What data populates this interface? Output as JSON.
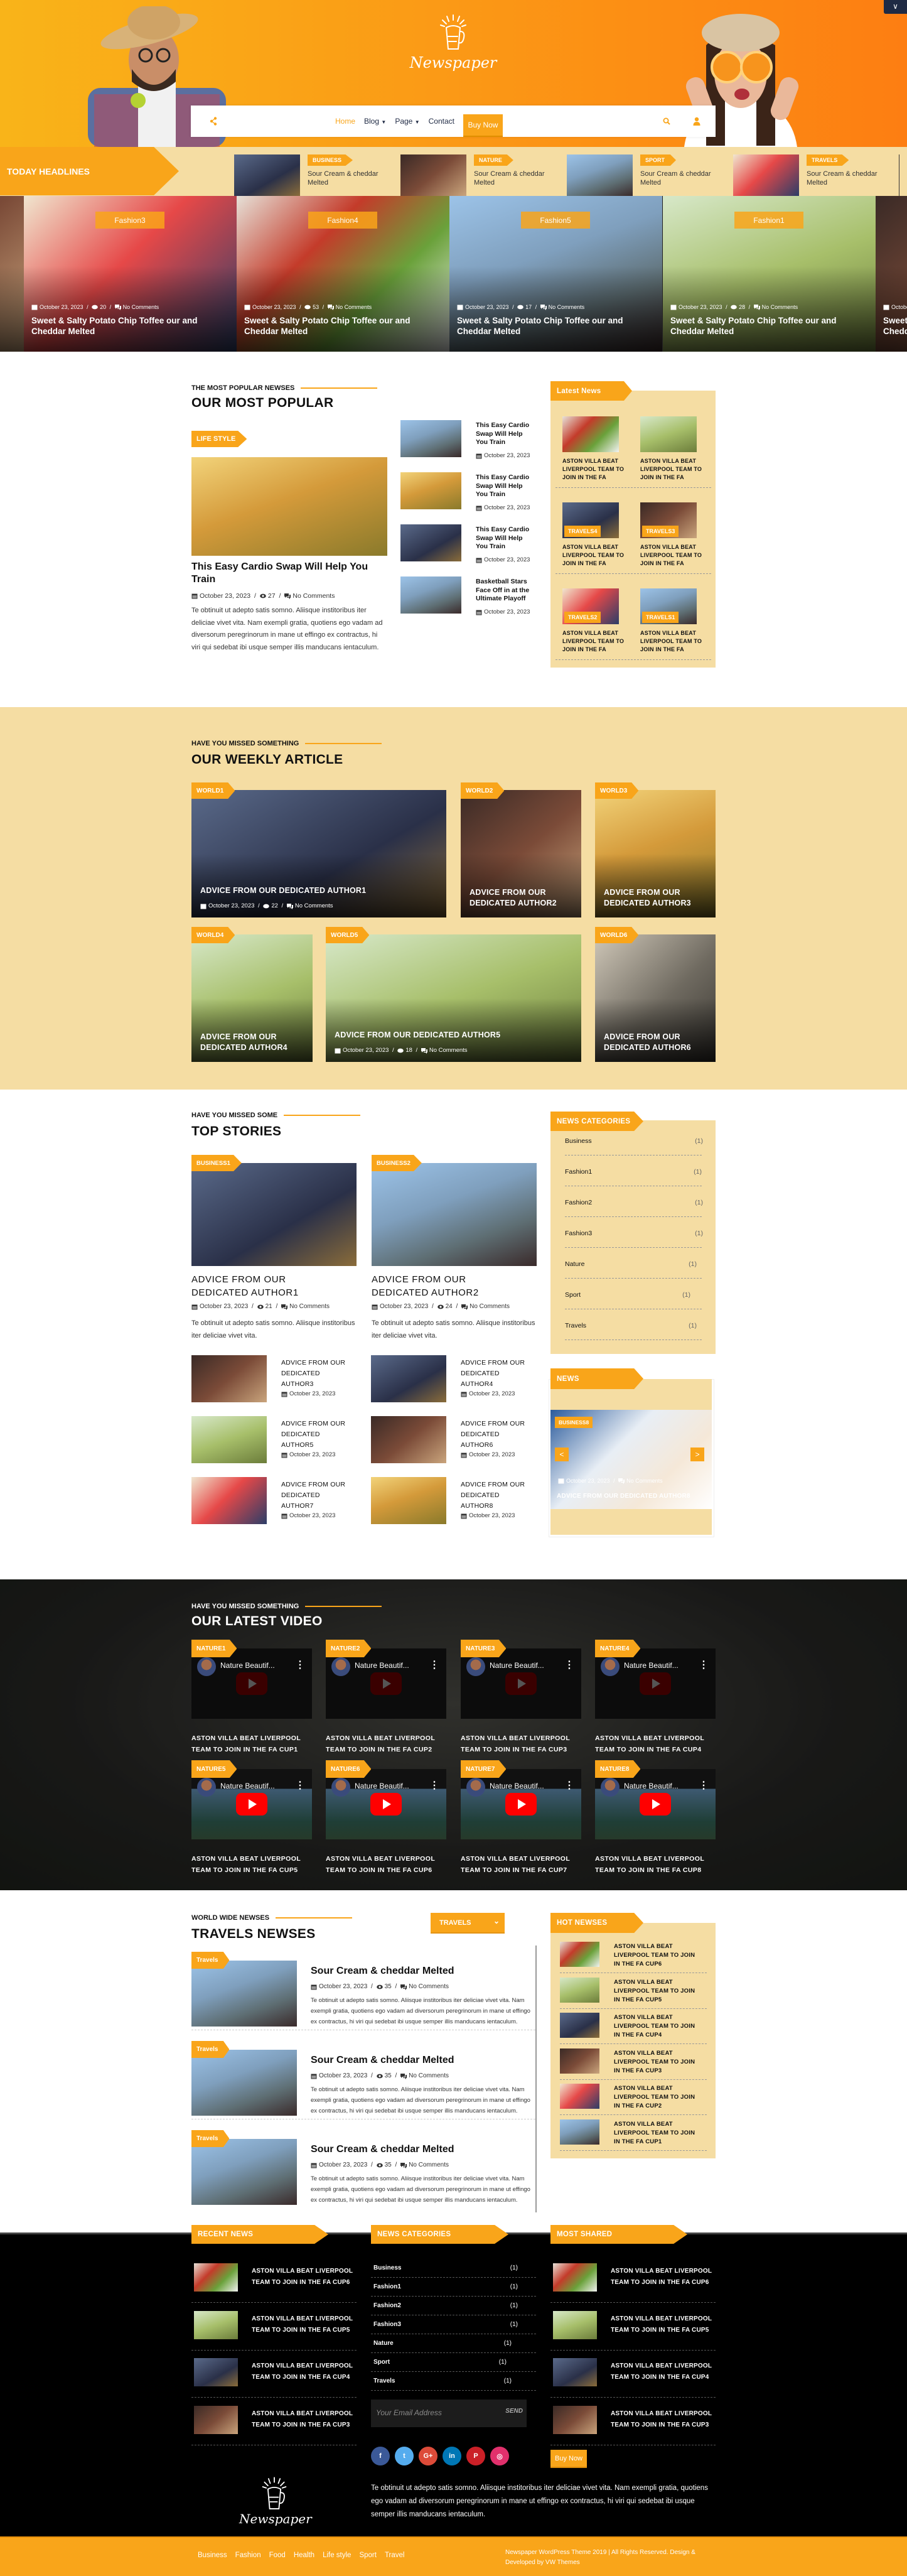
{
  "colors": {
    "accent": "#f9a51a",
    "beige": "#f5dda3",
    "footer_bg": "#000000",
    "header_gradient": [
      "#f9b419",
      "#fd7e12"
    ]
  },
  "header": {
    "logo_text": "Newspaper",
    "nav": {
      "items": [
        {
          "label": "Home",
          "active": true
        },
        {
          "label": "Blog",
          "dropdown": true
        },
        {
          "label": "Page",
          "dropdown": true
        },
        {
          "label": "Contact"
        }
      ],
      "buy_now": "Buy Now"
    },
    "icons": [
      "share-icon",
      "search-icon",
      "user-icon",
      "chevron-down-icon"
    ]
  },
  "headlines": {
    "label": "TODAY HEADLINES",
    "items": [
      {
        "tag": "Business",
        "title": "Sour Cream & cheddar Melted"
      },
      {
        "tag": "Nature",
        "title": "Sour Cream & cheddar Melted"
      },
      {
        "tag": "Sport",
        "title": "Sour Cream & cheddar Melted"
      },
      {
        "tag": "Travels",
        "title": "Sour Cream & cheddar Melted"
      }
    ]
  },
  "slider": {
    "slides": [
      {
        "date": "October 23, 2023",
        "title": "Sweet & Salty Potato Chip Toffee our and Cheddar Melted"
      },
      {
        "tag": "Fashion3",
        "date": "October 23, 2023",
        "views": "20",
        "comments": "No Comments",
        "title": "Sweet & Salty Potato Chip Toffee our and Cheddar Melted"
      },
      {
        "tag": "Fashion4",
        "date": "October 23, 2023",
        "views": "53",
        "comments": "No Comments",
        "title": "Sweet & Salty Potato Chip Toffee our and Cheddar Melted"
      },
      {
        "tag": "Fashion5",
        "date": "October 23, 2023",
        "views": "17",
        "comments": "No Comments",
        "title": "Sweet & Salty Potato Chip Toffee our and Cheddar Melted"
      },
      {
        "tag": "Fashion1",
        "date": "October 23, 2023",
        "views": "28",
        "comments": "No Comments",
        "title": "Sweet & Salty Potato Chip Toffee our and Cheddar Melted"
      },
      {
        "date": "October 23, 2023",
        "title": "Sweet & Salty Potato Chip Toffee our and Cheddar Melted"
      }
    ]
  },
  "popular": {
    "subtitle": "THE MOST POPULAR NEWSES",
    "title": "OUR MOST POPULAR",
    "featured": {
      "tag": "LIFE STYLE",
      "title": "This Easy Cardio Swap Will Help You Train",
      "date": "October 23, 2023",
      "views": "27",
      "comments": "No Comments",
      "excerpt": "Te obtinuit ut adepto satis somno. Aliisque institoribus iter deliciae vivet vita. Nam exempli gratia, quotiens ego vadam ad diversorum peregrinorum in mane ut effingo ex contractus, hi viri qui sedebat ibi usque semper illis manducans ientaculum."
    },
    "list": [
      {
        "title": "This Easy Cardio Swap Will Help You Train",
        "date": "October 23, 2023"
      },
      {
        "title": "This Easy Cardio Swap Will Help You Train",
        "date": "October 23, 2023"
      },
      {
        "title": "This Easy Cardio Swap Will Help You Train",
        "date": "October 23, 2023"
      },
      {
        "title": "Basketball Stars Face Off in at the Ultimate Playoff",
        "date": "October 23, 2023"
      }
    ],
    "latest": {
      "title": "Latest News",
      "items": [
        {
          "title": "ASTON VILLA BEAT LIVERPOOL TEAM TO JOIN IN THE FA CUP6..."
        },
        {
          "title": "ASTON VILLA BEAT LIVERPOOL TEAM TO JOIN IN THE FA CUP5..."
        },
        {
          "tag": "TRAVELS4",
          "title": "ASTON VILLA BEAT LIVERPOOL TEAM TO JOIN IN THE FA CUP4..."
        },
        {
          "tag": "TRAVELS3",
          "title": "ASTON VILLA BEAT LIVERPOOL TEAM TO JOIN IN THE FA CUP3..."
        },
        {
          "tag": "TRAVELS2",
          "title": "ASTON VILLA BEAT LIVERPOOL TEAM TO JOIN IN THE FA CUP2..."
        },
        {
          "tag": "TRAVELS1",
          "title": "ASTON VILLA BEAT LIVERPOOL TEAM TO JOIN IN THE FA CUP1..."
        }
      ]
    }
  },
  "weekly": {
    "subtitle": "HAVE YOU MISSED SOMETHING",
    "title": "OUR WEEKLY ARTICLE",
    "cards": [
      {
        "tag": "WORLD1",
        "title": "ADVICE FROM OUR DEDICATED AUTHOR1",
        "date": "October 23, 2023",
        "views": "22",
        "comments": "No Comments"
      },
      {
        "tag": "WORLD2",
        "title": "ADVICE FROM OUR DEDICATED AUTHOR2"
      },
      {
        "tag": "WORLD3",
        "title": "ADVICE FROM OUR DEDICATED AUTHOR3"
      },
      {
        "tag": "WORLD4",
        "title": "ADVICE FROM OUR DEDICATED AUTHOR4"
      },
      {
        "tag": "WORLD5",
        "title": "ADVICE FROM OUR DEDICATED AUTHOR5",
        "date": "October 23, 2023",
        "views": "18",
        "comments": "No Comments"
      },
      {
        "tag": "WORLD6",
        "title": "ADVICE FROM OUR DEDICATED AUTHOR6"
      }
    ]
  },
  "top_stories": {
    "subtitle": "HAVE YOU MISSED SOME",
    "title": "TOP STORIES",
    "featured": [
      {
        "tag": "BUSINESS1",
        "title": "ADVICE FROM OUR DEDICATED AUTHOR1",
        "date": "October 23, 2023",
        "views": "21",
        "comments": "No Comments",
        "excerpt": "Te obtinuit ut adepto satis somno. Aliisque institoribus iter deliciae vivet vita."
      },
      {
        "tag": "BUSINESS2",
        "title": "ADVICE FROM OUR DEDICATED AUTHOR2",
        "date": "October 23, 2023",
        "views": "24",
        "comments": "No Comments",
        "excerpt": "Te obtinuit ut adepto satis somno. Aliisque institoribus iter deliciae vivet vita."
      }
    ],
    "list": [
      {
        "title": "ADVICE FROM OUR DEDICATED AUTHOR3",
        "date": "October 23, 2023"
      },
      {
        "title": "ADVICE FROM OUR DEDICATED AUTHOR4",
        "date": "October 23, 2023"
      },
      {
        "title": "ADVICE FROM OUR DEDICATED AUTHOR5",
        "date": "October 23, 2023"
      },
      {
        "title": "ADVICE FROM OUR DEDICATED AUTHOR6",
        "date": "October 23, 2023"
      },
      {
        "title": "ADVICE FROM OUR DEDICATED AUTHOR7",
        "date": "October 23, 2023"
      },
      {
        "title": "ADVICE FROM OUR DEDICATED AUTHOR8",
        "date": "October 23, 2023"
      }
    ],
    "categories": {
      "title": "NEWS CATEGORIES",
      "items": [
        {
          "name": "Business",
          "count": "(1)"
        },
        {
          "name": "Fashion1",
          "count": "(1)"
        },
        {
          "name": "Fashion2",
          "count": "(1)"
        },
        {
          "name": "Fashion3",
          "count": "(1)"
        },
        {
          "name": "Nature",
          "count": "(1)"
        },
        {
          "name": "Sport",
          "count": "(1)"
        },
        {
          "name": "Travels",
          "count": "(1)"
        }
      ]
    },
    "news_widget": {
      "title": "NEWS",
      "slide": {
        "tag": "BUSINESS8",
        "date": "October 23, 2023",
        "comments": "No Comments",
        "title": "ADVICE FROM OUR DEDICATED AUTHOR8"
      },
      "prev": "<",
      "next": ">"
    }
  },
  "video": {
    "subtitle": "HAVE YOU MISSED SOMETHING",
    "title": "OUR LATEST VIDEO",
    "items": [
      {
        "tag": "NATURE1",
        "video_title": "Nature Beautif...",
        "caption": "ASTON VILLA BEAT LIVERPOOL TEAM TO JOIN IN THE FA CUP1"
      },
      {
        "tag": "NATURE2",
        "video_title": "Nature Beautif...",
        "caption": "ASTON VILLA BEAT LIVERPOOL TEAM TO JOIN IN THE FA CUP2"
      },
      {
        "tag": "NATURE3",
        "video_title": "Nature Beautif...",
        "caption": "ASTON VILLA BEAT LIVERPOOL TEAM TO JOIN IN THE FA CUP3"
      },
      {
        "tag": "NATURE4",
        "video_title": "Nature Beautif...",
        "caption": "ASTON VILLA BEAT LIVERPOOL TEAM TO JOIN IN THE FA CUP4"
      },
      {
        "tag": "NATURE5",
        "video_title": "Nature Beautif...",
        "caption": "ASTON VILLA BEAT LIVERPOOL TEAM TO JOIN IN THE FA CUP5"
      },
      {
        "tag": "NATURE6",
        "video_title": "Nature Beautif...",
        "caption": "ASTON VILLA BEAT LIVERPOOL TEAM TO JOIN IN THE FA CUP6"
      },
      {
        "tag": "NATURE7",
        "video_title": "Nature Beautif...",
        "caption": "ASTON VILLA BEAT LIVERPOOL TEAM TO JOIN IN THE FA CUP7"
      },
      {
        "tag": "NATURE8",
        "video_title": "Nature Beautif...",
        "caption": "ASTON VILLA BEAT LIVERPOOL TEAM TO JOIN IN THE FA CUP8"
      }
    ]
  },
  "travels": {
    "subtitle": "WORLD WIDE NEWSES",
    "title": "TRAVELS NEWSES",
    "dropdown": "TRAVELS",
    "posts": [
      {
        "tag": "Travels",
        "title": "Sour Cream & cheddar Melted",
        "date": "October 23, 2023",
        "views": "35",
        "comments": "No Comments",
        "excerpt": "Te obtinuit ut adepto satis somno. Aliisque institoribus iter deliciae vivet vita. Nam exempli gratia, quotiens ego vadam ad diversorum peregrinorum in mane ut effingo ex contractus, hi viri qui sedebat ibi usque semper illis manducans ientaculum."
      },
      {
        "tag": "Travels",
        "title": "Sour Cream & cheddar Melted",
        "date": "October 23, 2023",
        "views": "35",
        "comments": "No Comments",
        "excerpt": "Te obtinuit ut adepto satis somno. Aliisque institoribus iter deliciae vivet vita. Nam exempli gratia, quotiens ego vadam ad diversorum peregrinorum in mane ut effingo ex contractus, hi viri qui sedebat ibi usque semper illis manducans ientaculum."
      },
      {
        "tag": "Travels",
        "title": "Sour Cream & cheddar Melted",
        "date": "October 23, 2023",
        "views": "35",
        "comments": "No Comments",
        "excerpt": "Te obtinuit ut adepto satis somno. Aliisque institoribus iter deliciae vivet vita. Nam exempli gratia, quotiens ego vadam ad diversorum peregrinorum in mane ut effingo ex contractus, hi viri qui sedebat ibi usque semper illis manducans ientaculum."
      }
    ],
    "hot": {
      "title": "HOT NEWSES",
      "items": [
        {
          "title": "ASTON VILLA BEAT LIVERPOOL TEAM TO JOIN IN THE FA CUP6"
        },
        {
          "title": "ASTON VILLA BEAT LIVERPOOL TEAM TO JOIN IN THE FA CUP5"
        },
        {
          "title": "ASTON VILLA BEAT LIVERPOOL TEAM TO JOIN IN THE FA CUP4"
        },
        {
          "title": "ASTON VILLA BEAT LIVERPOOL TEAM TO JOIN IN THE FA CUP3"
        },
        {
          "title": "ASTON VILLA BEAT LIVERPOOL TEAM TO JOIN IN THE FA CUP2"
        },
        {
          "title": "ASTON VILLA BEAT LIVERPOOL TEAM TO JOIN IN THE FA CUP1"
        }
      ]
    }
  },
  "footer": {
    "recent": {
      "title": "RECENT NEWS",
      "items": [
        {
          "title": "ASTON VILLA BEAT LIVERPOOL TEAM TO JOIN IN THE FA CUP6"
        },
        {
          "title": "ASTON VILLA BEAT LIVERPOOL TEAM TO JOIN IN THE FA CUP5"
        },
        {
          "title": "ASTON VILLA BEAT LIVERPOOL TEAM TO JOIN IN THE FA CUP4"
        },
        {
          "title": "ASTON VILLA BEAT LIVERPOOL TEAM TO JOIN IN THE FA CUP3"
        }
      ]
    },
    "categories": {
      "title": "NEWS CATEGORIES",
      "items": [
        {
          "name": "Business",
          "count": "(1)"
        },
        {
          "name": "Fashion1",
          "count": "(1)"
        },
        {
          "name": "Fashion2",
          "count": "(1)"
        },
        {
          "name": "Fashion3",
          "count": "(1)"
        },
        {
          "name": "Nature",
          "count": "(1)"
        },
        {
          "name": "Sport",
          "count": "(1)"
        },
        {
          "name": "Travels",
          "count": "(1)"
        }
      ]
    },
    "newsletter": {
      "placeholder": "Your Email Address",
      "send": "SEND"
    },
    "social": [
      {
        "icon": "facebook-icon",
        "glyph": "f",
        "color": "#3b5998"
      },
      {
        "icon": "twitter-icon",
        "glyph": "t",
        "color": "#55acee"
      },
      {
        "icon": "google-plus-icon",
        "glyph": "G+",
        "color": "#dd4b39"
      },
      {
        "icon": "linkedin-icon",
        "glyph": "in",
        "color": "#0077b5"
      },
      {
        "icon": "pinterest-icon",
        "glyph": "P",
        "color": "#cb2027"
      },
      {
        "icon": "instagram-icon",
        "glyph": "◎",
        "color": "#e1306c"
      }
    ],
    "most_shared": {
      "title": "MOST SHARED",
      "items": [
        {
          "title": "ASTON VILLA BEAT LIVERPOOL TEAM TO JOIN IN THE FA CUP6"
        },
        {
          "title": "ASTON VILLA BEAT LIVERPOOL TEAM TO JOIN IN THE FA CUP5"
        },
        {
          "title": "ASTON VILLA BEAT LIVERPOOL TEAM TO JOIN IN THE FA CUP4"
        },
        {
          "title": "ASTON VILLA BEAT LIVERPOOL TEAM TO JOIN IN THE FA CUP3"
        }
      ]
    },
    "buy_now": "Buy Now",
    "logo_text": "Newspaper",
    "about": "Te obtinuit ut adepto satis somno. Aliisque institoribus iter deliciae vivet vita. Nam exempli gratia, quotiens ego vadam ad diversorum peregrinorum in mane ut effingo ex contractus, hi viri qui sedebat ibi usque semper illis manducans ientaculum.",
    "links": [
      "Business",
      "Fashion",
      "Food",
      "Health",
      "Life style",
      "Sport",
      "Travel"
    ],
    "copyright": "Newspaper WordPress Theme 2019 | All Rights Reserved. Design & Developed by VW Themes"
  }
}
